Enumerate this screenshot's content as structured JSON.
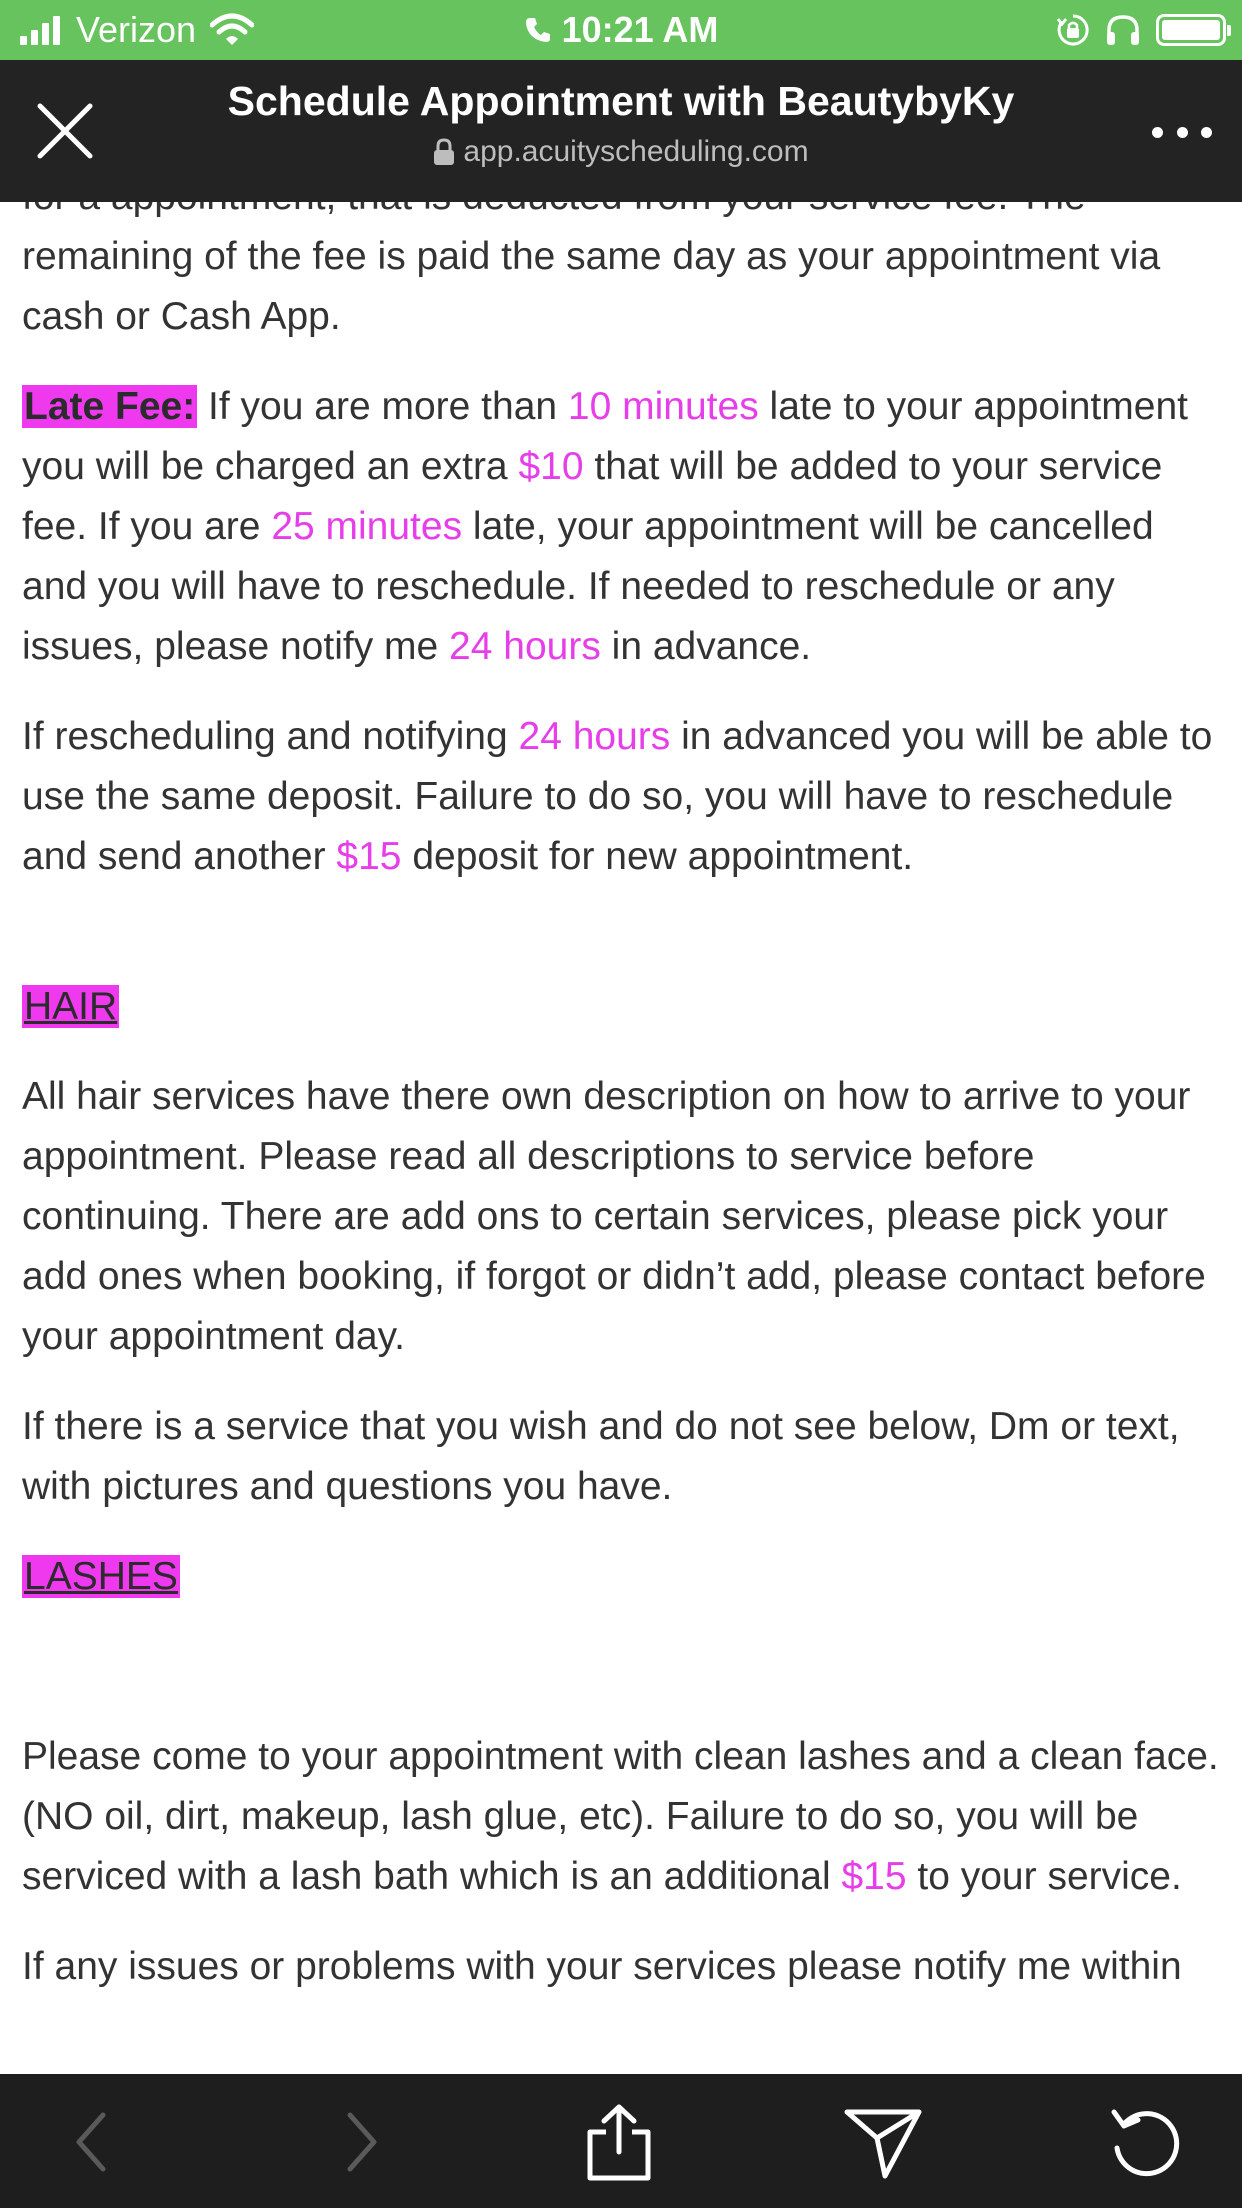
{
  "status_bar": {
    "carrier": "Verizon",
    "time": "10:21 AM"
  },
  "browser": {
    "title": "Schedule Appointment with BeautybyKy",
    "url": "app.acuityscheduling.com"
  },
  "content": {
    "p_deposit": {
      "text": "for a appointment, that is deducted from your service fee. The remaining of the fee is paid the same day as your appointment via cash or Cash App."
    },
    "p_late": {
      "tag": "Late Fee:",
      "t1": " If you are more than ",
      "h1": "10 minutes",
      "t2": " late to your appointment you will be charged an extra ",
      "h2": "$10",
      "t3": " that will be added to your service fee. If you are ",
      "h3": "25 minutes",
      "t4": " late, your appointment will be cancelled and you will have to reschedule. If needed to reschedule or any issues, please notify me ",
      "h4": "24 hours",
      "t5": " in advance."
    },
    "p_resched": {
      "t1": "If rescheduling and notifying ",
      "h1": "24 hours",
      "t2": " in advanced you will be able to use the same deposit. Failure to do so, you will have to reschedule and send another ",
      "h2": "$15",
      "t3": " deposit for new appointment."
    },
    "hair_heading": "HAIR",
    "p_hair": "All hair services have there own description on how to arrive to your appointment. Please read all descriptions to service before continuing. There are add ons to certain services, please pick your add ones when booking, if forgot or didn’t add, please contact before your appointment day.",
    "p_service": "If there is a service that you wish and do not see below, Dm or text, with pictures and questions you have.",
    "lashes_heading": "LASHES",
    "p_lashes": {
      "t1": "Please come to your appointment with clean lashes and a clean face.(NO oil, dirt, makeup, lash glue, etc). Failure to do so, you will be serviced with a lash bath which is an additional ",
      "h1": "$15",
      "t2": " to your service."
    },
    "p_issues": "If any issues or problems with your services please notify me within"
  },
  "colors": {
    "status_bar": "#66c35e",
    "header": "#232323",
    "highlight": "#ee39ef",
    "pink_text": "#e63ee9",
    "toolbar": "#1e1e1e"
  },
  "toolbar": {
    "icons": [
      "back-icon",
      "forward-icon",
      "share-icon",
      "send-icon",
      "reload-icon"
    ]
  }
}
